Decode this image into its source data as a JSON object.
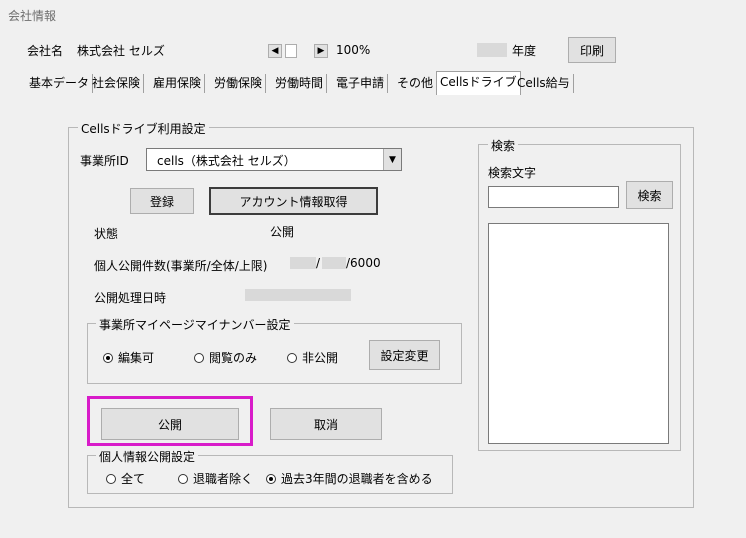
{
  "window_title": "会社情報",
  "header": {
    "company_label": "会社名",
    "company_name": "株式会社 セルズ",
    "zoom": "100%",
    "year_suffix": "年度",
    "print_label": "印刷"
  },
  "tabs": [
    {
      "label": "基本データ"
    },
    {
      "label": "社会保険"
    },
    {
      "label": "雇用保険"
    },
    {
      "label": "労働保険"
    },
    {
      "label": "労働時間"
    },
    {
      "label": "電子申請"
    },
    {
      "label": "その他"
    },
    {
      "label": "Cellsドライブ"
    },
    {
      "label": "Cells給与"
    }
  ],
  "settings": {
    "group_title": "Cellsドライブ利用設定",
    "office_id_label": "事業所ID",
    "office_id_value": "cells（株式会社 セルズ）",
    "register_label": "登録",
    "get_account_label": "アカウント情報取得",
    "status_label": "状態",
    "status_value": "公開",
    "count_label": "個人公開件数(事業所/全体/上限)",
    "count_sep1": "/",
    "count_sep2": "/6000",
    "processed_label": "公開処理日時",
    "mypage_group_title": "事業所マイページマイナンバー設定",
    "mypage_options": [
      "編集可",
      "閲覧のみ",
      "非公開"
    ],
    "mypage_selected": "編集可",
    "change_settings_label": "設定変更",
    "publish_label": "公開",
    "cancel_label": "取消",
    "personal_group_title": "個人情報公開設定",
    "personal_options": [
      "全て",
      "退職者除く",
      "過去3年間の退職者を含める"
    ],
    "personal_selected": "過去3年間の退職者を含める"
  },
  "search": {
    "group_title": "検索",
    "text_label": "検索文字",
    "input_value": "",
    "button_label": "検索"
  },
  "colors": {
    "highlight": "#d81bc9",
    "background": "#f0f0f0",
    "redaction": "#d9d9d9"
  }
}
